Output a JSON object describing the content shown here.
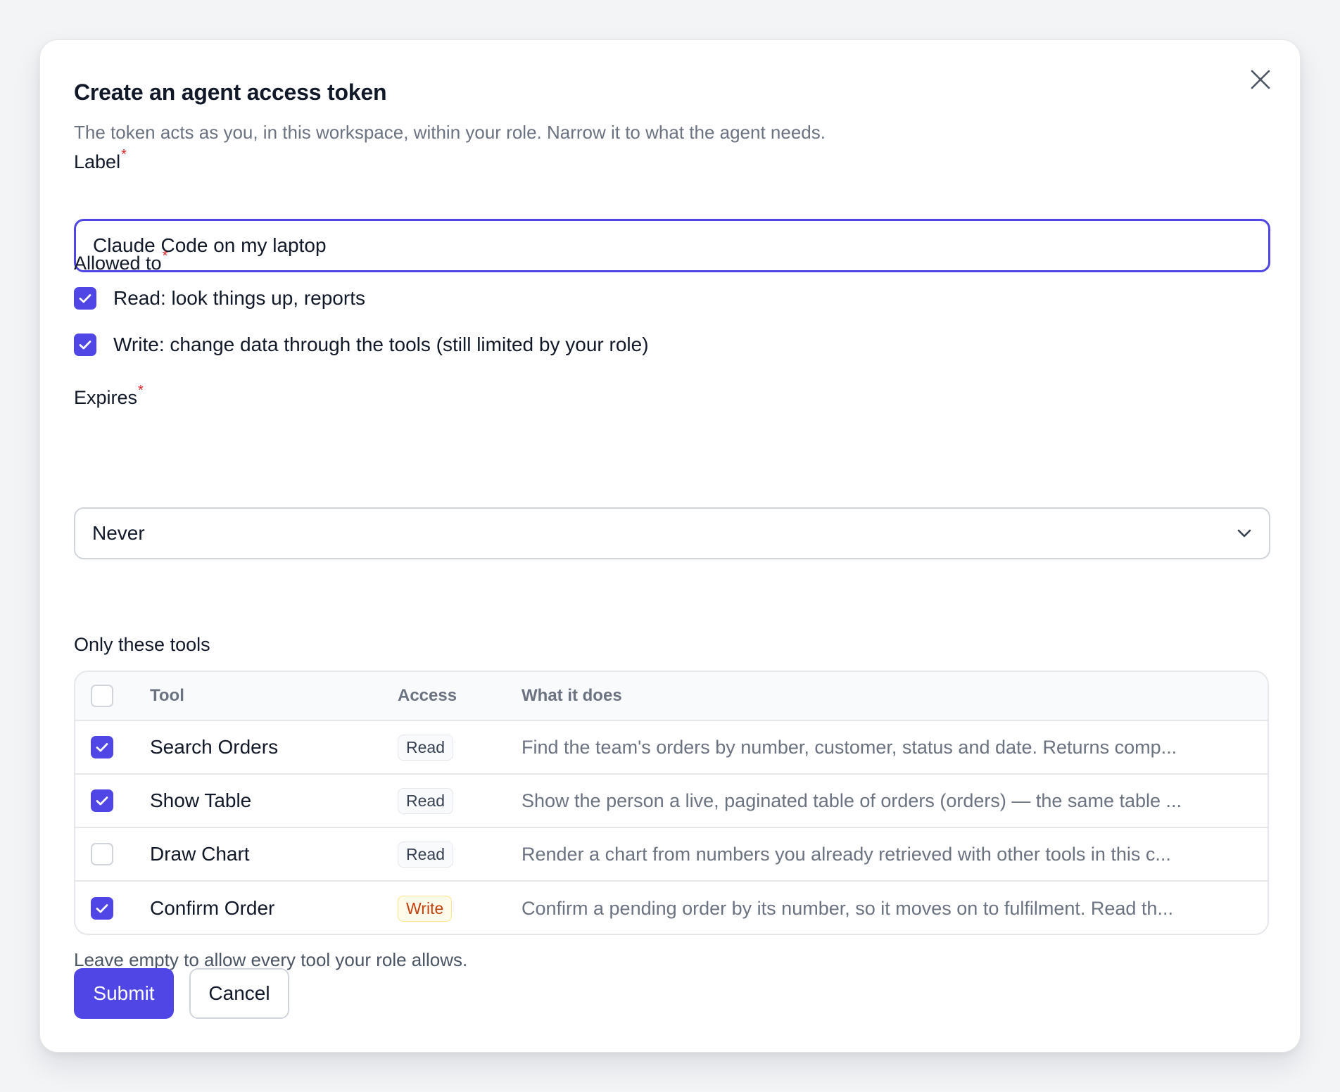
{
  "dialog": {
    "title": "Create an agent access token",
    "subtitle": "The token acts as you, in this workspace, within your role. Narrow it to what the agent needs.",
    "close_icon": "close-icon"
  },
  "label_field": {
    "label": "Label",
    "required_mark": "*",
    "value": "Claude Code on my laptop"
  },
  "allowed": {
    "label": "Allowed to",
    "required_mark": "*",
    "options": [
      {
        "label": "Read: look things up, reports",
        "checked": true
      },
      {
        "label": "Write: change data through the tools (still limited by your role)",
        "checked": true
      }
    ]
  },
  "expires": {
    "label": "Expires",
    "required_mark": "*",
    "value": "Never",
    "icon": "chevron-down-icon"
  },
  "tools": {
    "label": "Only these tools",
    "columns": [
      "Tool",
      "Access",
      "What it does"
    ],
    "select_all_checked": false,
    "rows": [
      {
        "checked": true,
        "name": "Search Orders",
        "access": "Read",
        "description": "Find the team's orders by number, customer, status and date. Returns comp..."
      },
      {
        "checked": true,
        "name": "Show Table",
        "access": "Read",
        "description": "Show the person a live, paginated table of orders (orders) — the same table ..."
      },
      {
        "checked": false,
        "name": "Draw Chart",
        "access": "Read",
        "description": "Render a chart from numbers you already retrieved with other tools in this c..."
      },
      {
        "checked": true,
        "name": "Confirm Order",
        "access": "Write",
        "description": "Confirm a pending order by its number, so it moves on to fulfilment. Read th..."
      }
    ],
    "hint": "Leave empty to allow every tool your role allows."
  },
  "actions": {
    "submit": "Submit",
    "cancel": "Cancel"
  },
  "colors": {
    "accent": "#4f46e5",
    "required": "#dc2626",
    "write_badge": "#c2410c"
  }
}
